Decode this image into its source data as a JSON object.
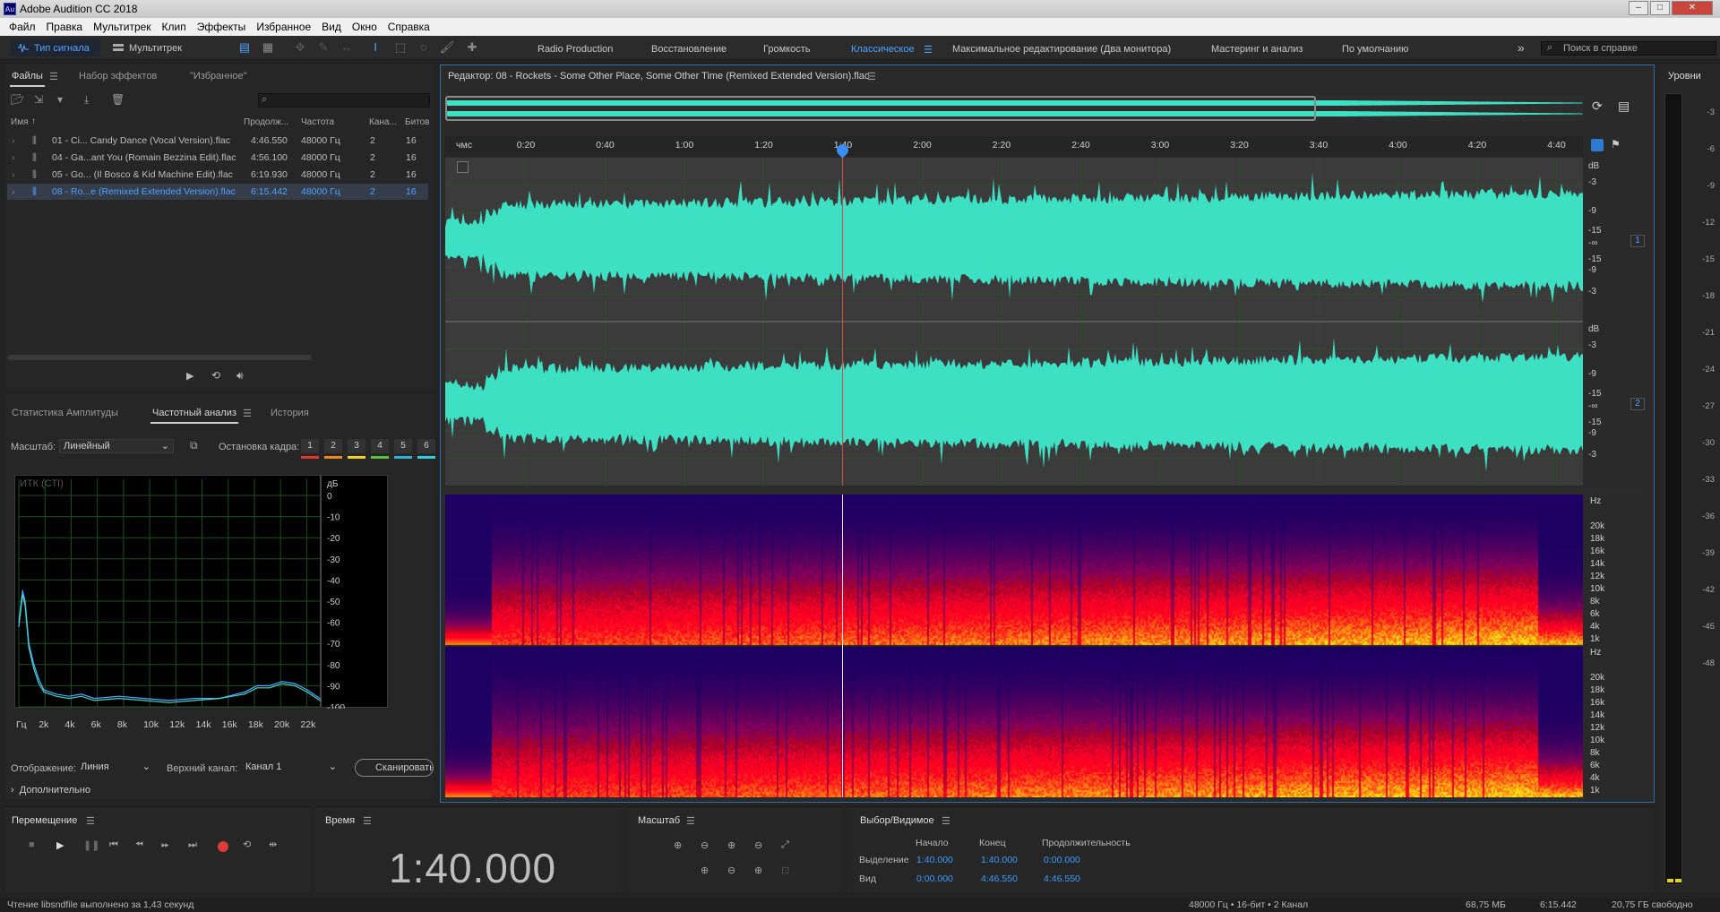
{
  "app": {
    "title": "Adobe Audition CC 2018",
    "logo": "Au",
    "window_buttons": [
      "–",
      "□",
      "✕"
    ]
  },
  "menu": [
    "Файл",
    "Правка",
    "Мультитрек",
    "Клип",
    "Эффекты",
    "Избранное",
    "Вид",
    "Окно",
    "Справка"
  ],
  "toolbar": {
    "mode_waveform": "Тип сигнала",
    "mode_multitrack": "Мультитрек",
    "workspaces": [
      "Radio Production",
      "Восстановление",
      "Громкость",
      "Классическое",
      "Максимальное редактирование (Два монитора)",
      "Мастеринг и анализ",
      "По умолчанию"
    ],
    "active_workspace": "Классическое",
    "more": "»",
    "search_placeholder": "Поиск в справке"
  },
  "files_panel": {
    "tabs": [
      "Файлы",
      "Набор эффектов",
      "\"Избранное\""
    ],
    "search_icon": "⌕",
    "columns": [
      "Имя",
      "Продолж...",
      "Частота",
      "Кана...",
      "Битов"
    ],
    "rows": [
      {
        "name": "01 - Ci... Candy Dance (Vocal Version).flac",
        "duration": "4:46.550",
        "rate": "48000 Гц",
        "channels": "2",
        "bits": "16",
        "selected": false
      },
      {
        "name": "04 - Ga...ant You (Romain Bezzina Edit).flac",
        "duration": "4:56.100",
        "rate": "48000 Гц",
        "channels": "2",
        "bits": "16",
        "selected": false
      },
      {
        "name": "05 - Go... (Il Bosco & Kid Machine Edit).flac",
        "duration": "6:19.930",
        "rate": "48000 Гц",
        "channels": "2",
        "bits": "16",
        "selected": false
      },
      {
        "name": "08 - Ro...e (Remixed Extended Version).flac",
        "duration": "6:15.442",
        "rate": "48000 Гц",
        "channels": "2",
        "bits": "16",
        "selected": true
      }
    ]
  },
  "analysis_panel": {
    "tabs": [
      "Статистика Амплитуды",
      "Частотный анализ",
      "История"
    ],
    "scale_label": "Масштаб:",
    "scale_value": "Линейный",
    "freeze_label": "Остановка кадра:",
    "freeze_numbers": [
      "1",
      "2",
      "3",
      "4",
      "5",
      "6"
    ],
    "freeze_colors": [
      "#e0392b",
      "#f08a1c",
      "#f2d21b",
      "#5bc23a",
      "#31b4d8",
      "#2fd0e0"
    ],
    "chart_caption": "ИТК (СТІ)",
    "display_label": "Отображение:",
    "display_value": "Линия",
    "channel_label": "Верхний канал:",
    "channel_value": "Канал 1",
    "scan_button": "Сканировать",
    "advanced": "Дополнительно"
  },
  "chart_data": {
    "type": "line",
    "title": "",
    "xlabel": "",
    "ylabel": "",
    "x_ticks": [
      "Гц",
      "2k",
      "4k",
      "6k",
      "8k",
      "10k",
      "12k",
      "14k",
      "16k",
      "18k",
      "20k",
      "22k"
    ],
    "y_unit": "дБ",
    "y_ticks": [
      "0",
      "-10",
      "-20",
      "-30",
      "-40",
      "-50",
      "-60",
      "-70",
      "-80",
      "-90",
      "-100"
    ],
    "xlim": [
      0,
      24000
    ],
    "ylim": [
      -100,
      0
    ],
    "series": [
      {
        "color": "#4fa8ff",
        "x": [
          0,
          300,
          500,
          800,
          1200,
          1600,
          2000,
          3000,
          4000,
          5000,
          6000,
          8000,
          10000,
          12000,
          14000,
          16000,
          18000,
          19000,
          20000,
          21000,
          22000,
          23000,
          24000
        ],
        "values": [
          -60,
          -45,
          -50,
          -70,
          -80,
          -87,
          -92,
          -94,
          -95,
          -94,
          -96,
          -95,
          -96,
          -97,
          -96,
          -96,
          -93,
          -90,
          -90,
          -88,
          -89,
          -92,
          -96
        ]
      },
      {
        "color": "#3fd8c8",
        "x": [
          0,
          300,
          500,
          800,
          1200,
          1600,
          2000,
          3000,
          4000,
          5000,
          6000,
          8000,
          10000,
          12000,
          14000,
          16000,
          18000,
          19000,
          20000,
          21000,
          22000,
          23000,
          24000
        ],
        "values": [
          -62,
          -47,
          -52,
          -72,
          -82,
          -89,
          -93,
          -95,
          -96,
          -95,
          -97,
          -96,
          -97,
          -98,
          -97,
          -96,
          -94,
          -91,
          -91,
          -89,
          -90,
          -93,
          -97
        ]
      }
    ]
  },
  "editor": {
    "title": "Редактор: 08 - Rockets - Some Other Place, Some Other Time (Remixed Extended Version).flac",
    "ruler_unit": "чмс",
    "ruler_ticks": [
      "0:20",
      "0:40",
      "1:00",
      "1:20",
      "1:40",
      "2:00",
      "2:20",
      "2:40",
      "3:00",
      "3:20",
      "3:40",
      "4:00",
      "4:20",
      "4:40"
    ],
    "db_labels_ch": [
      "dB",
      "-3",
      "-9",
      "-15",
      "-∞",
      "-15",
      "-9",
      "-3"
    ],
    "channel_1": "1",
    "channel_2": "2",
    "hz_labels": [
      "Hz",
      "20k",
      "18k",
      "16k",
      "14k",
      "12k",
      "10k",
      "8k",
      "6k",
      "4k",
      "1k"
    ],
    "wave_color": "#3ee0c4",
    "playhead": "1:40"
  },
  "levels_panel": {
    "title": "Уровни",
    "ticks": [
      "-3",
      "-6",
      "-9",
      "-12",
      "-15",
      "-18",
      "-21",
      "-24",
      "-27",
      "-30",
      "-33",
      "-36",
      "-39",
      "-42",
      "-45",
      "-48"
    ]
  },
  "transport": {
    "title": "Перемещение"
  },
  "time_panel": {
    "title": "Время",
    "value": "1:40.000"
  },
  "zoom_panel": {
    "title": "Масштаб"
  },
  "selection_panel": {
    "title": "Выбор/Видимое",
    "headers": [
      "Начало",
      "Конец",
      "Продолжительность"
    ],
    "rows": [
      {
        "label": "Выделение",
        "start": "1:40.000",
        "end": "1:40.000",
        "duration": "0:00.000"
      },
      {
        "label": "Вид",
        "start": "0:00.000",
        "end": "4:46.550",
        "duration": "4:46.550"
      }
    ]
  },
  "status": {
    "left": "Чтение libsndfile выполнено за 1,43 секунд",
    "format": "48000 Гц • 16-бит • 2 Канал",
    "size": "68,75 МБ",
    "duration": "6:15.442",
    "free": "20,75 ГБ свободно"
  }
}
